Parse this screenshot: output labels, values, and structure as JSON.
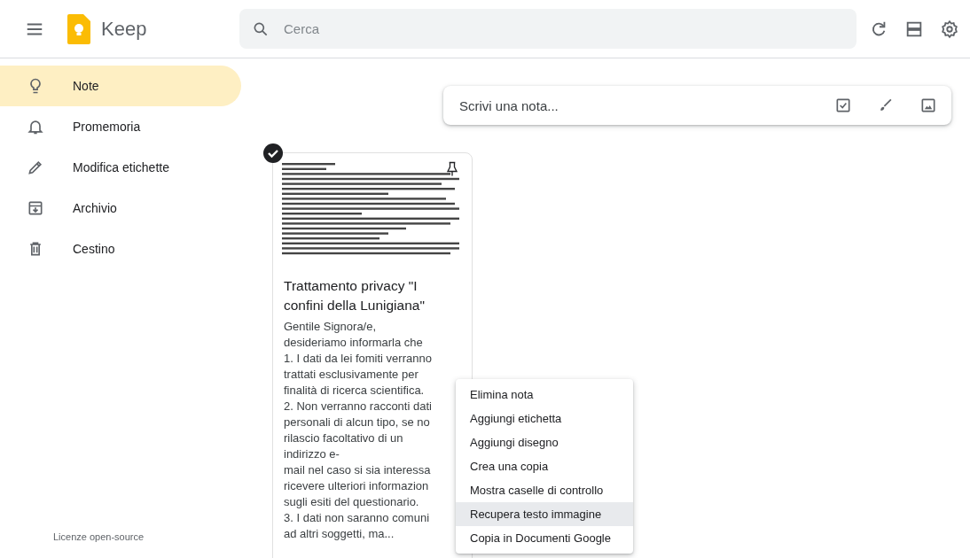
{
  "header": {
    "app_name": "Keep",
    "search": {
      "placeholder": "Cerca"
    }
  },
  "sidebar": {
    "items": [
      {
        "label": "Note",
        "selected": true
      },
      {
        "label": "Promemoria",
        "selected": false
      },
      {
        "label": "Modifica etichette",
        "selected": false
      },
      {
        "label": "Archivio",
        "selected": false
      },
      {
        "label": "Cestino",
        "selected": false
      }
    ],
    "footer_link": "Licenze open-source"
  },
  "composer": {
    "placeholder": "Scrivi una nota..."
  },
  "note": {
    "selected": true,
    "title": "Trattamento privacy \"I confini della Lunigiana\"",
    "body_lines": [
      "Gentile Signora/e,",
      "desideriamo informarla che",
      "1. I dati da lei fomiti verranno",
      "trattati esclusivamente per",
      "finalità di ricerca scientifica.",
      "2. Non verranno racconti dati",
      "personali di alcun tipo, se no",
      "rilascio facoltativo di un",
      "indirizzo e-",
      "mail nel caso si sia interessa",
      "ricevere ulteriori informazion",
      "sugli esiti del questionario.",
      "3. I dati non saranno comuni",
      "ad altri soggetti, ma..."
    ]
  },
  "context_menu": {
    "items": [
      {
        "label": "Elimina nota",
        "selected": false
      },
      {
        "label": "Aggiungi etichetta",
        "selected": false
      },
      {
        "label": "Aggiungi disegno",
        "selected": false
      },
      {
        "label": "Crea una copia",
        "selected": false
      },
      {
        "label": "Mostra caselle di controllo",
        "selected": false
      },
      {
        "label": "Recupera testo immagine",
        "selected": true
      },
      {
        "label": "Copia in Documenti Google",
        "selected": false
      }
    ]
  }
}
